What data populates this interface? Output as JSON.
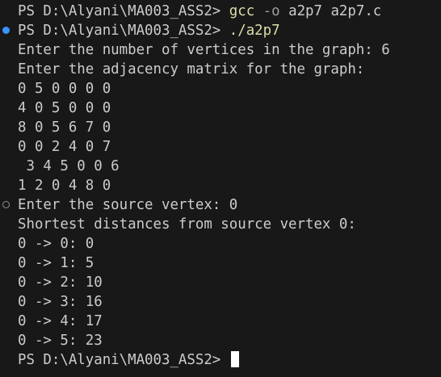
{
  "terminal": {
    "prompt_1": "PS D:\\Alyani\\MA003_ASS2> ",
    "cmd_1": {
      "program": "gcc",
      "flag": "-o",
      "args": "a2p7 a2p7.c"
    },
    "prompt_2": "PS D:\\Alyani\\MA003_ASS2> ",
    "cmd_2": "./a2p7",
    "output": [
      "Enter the number of vertices in the graph: 6",
      "Enter the adjacency matrix for the graph:",
      "0 5 0 0 0 0",
      "4 0 5 0 0 0",
      "8 0 5 6 7 0",
      "0 0 2 4 0 7",
      " 3 4 5 0 0 6",
      "1 2 0 4 8 0",
      "Enter the source vertex: 0",
      "Shortest distances from source vertex 0:",
      "0 -> 0: 0",
      "0 -> 1: 5",
      "0 -> 2: 10",
      "0 -> 3: 16",
      "0 -> 4: 17",
      "0 -> 5: 23"
    ],
    "prompt_3": "PS D:\\Alyani\\MA003_ASS2> "
  },
  "colors": {
    "background": "#181818",
    "text": "#cccccc",
    "command": "#dcdcaa",
    "flag": "#9d9d9d",
    "decoration_success": "#3794ff"
  }
}
